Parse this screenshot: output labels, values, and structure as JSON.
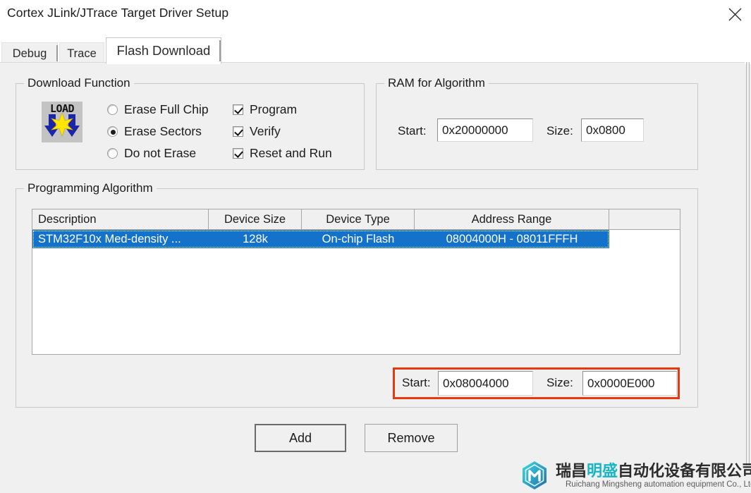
{
  "window": {
    "title": "Cortex JLink/JTrace Target Driver Setup",
    "close_icon": "close-icon"
  },
  "tabs": [
    {
      "label": "Debug",
      "active": false
    },
    {
      "label": "Trace",
      "active": false
    },
    {
      "label": "Flash Download",
      "active": true
    }
  ],
  "download_function": {
    "group_label": "Download Function",
    "icon": {
      "name": "load-icon",
      "text": "LOAD"
    },
    "radios": [
      {
        "label": "Erase Full Chip",
        "selected": false
      },
      {
        "label": "Erase Sectors",
        "selected": true
      },
      {
        "label": "Do not Erase",
        "selected": false
      }
    ],
    "checkboxes": [
      {
        "label": "Program",
        "checked": true
      },
      {
        "label": "Verify",
        "checked": true
      },
      {
        "label": "Reset and Run",
        "checked": true
      }
    ]
  },
  "ram_for_algorithm": {
    "group_label": "RAM for Algorithm",
    "start_label": "Start:",
    "start_value": "0x20000000",
    "size_label": "Size:",
    "size_value": "0x0800"
  },
  "programming_algorithm": {
    "group_label": "Programming Algorithm",
    "columns": [
      "Description",
      "Device Size",
      "Device Type",
      "Address Range",
      ""
    ],
    "rows": [
      {
        "description": "STM32F10x Med-density ...",
        "device_size": "128k",
        "device_type": "On-chip Flash",
        "address_range": "08004000H - 08011FFFH",
        "selected": true
      }
    ],
    "start_label": "Start:",
    "start_value": "0x08004000",
    "size_label": "Size:",
    "size_value": "0x0000E000",
    "highlight_color": "#e8380f"
  },
  "buttons": {
    "add": "Add",
    "remove": "Remove"
  },
  "watermark": {
    "cn_prefix": "瑞昌",
    "cn_accent": "明盛",
    "cn_suffix": "自动化设备有限公司",
    "en": "Ruichang Mingsheng automation equipment Co., Ltd",
    "accent_color": "#18b5c4"
  },
  "colors": {
    "selection_blue": "#1572cb",
    "window_bg": "#f0f0f0",
    "red_highlight": "#e8380f"
  }
}
